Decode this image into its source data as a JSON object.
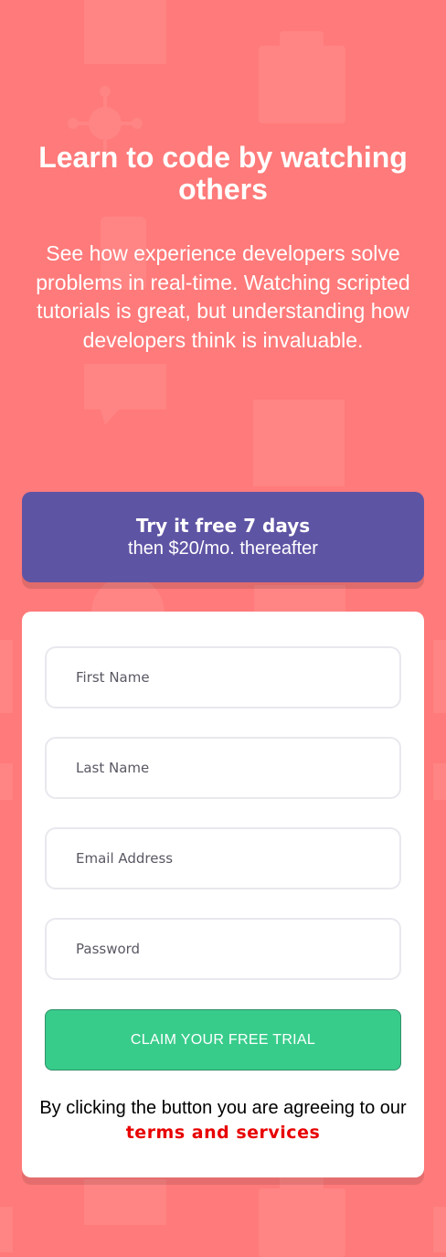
{
  "colors": {
    "background": "#ff7a7a",
    "offer_background": "#5e54a4",
    "card_background": "#ffffff",
    "cta_background": "#38cc8b",
    "link": "#e80000"
  },
  "background_icons": [
    "house-icon",
    "toolbox-icon",
    "virus-icon",
    "phone-icon",
    "chat-icon",
    "browser-window-icon",
    "gear-icon",
    "document-icon"
  ],
  "hero": {
    "title": "Learn to code by watching others",
    "description": "See how experience developers solve problems in real-time. Watching scripted tutorials is great, but understanding how developers think is invaluable."
  },
  "offer": {
    "strong": "Try it free 7 days",
    "rest": "then $20/mo. thereafter"
  },
  "form": {
    "first_name": {
      "placeholder": "First Name",
      "value": ""
    },
    "last_name": {
      "placeholder": "Last Name",
      "value": ""
    },
    "email": {
      "placeholder": "Email Address",
      "value": ""
    },
    "password": {
      "placeholder": "Password",
      "value": ""
    },
    "submit_label": "CLAIM YOUR FREE TRIAL",
    "terms_prefix": "By clicking the button you are agreeing to our ",
    "terms_link": "terms and services"
  }
}
